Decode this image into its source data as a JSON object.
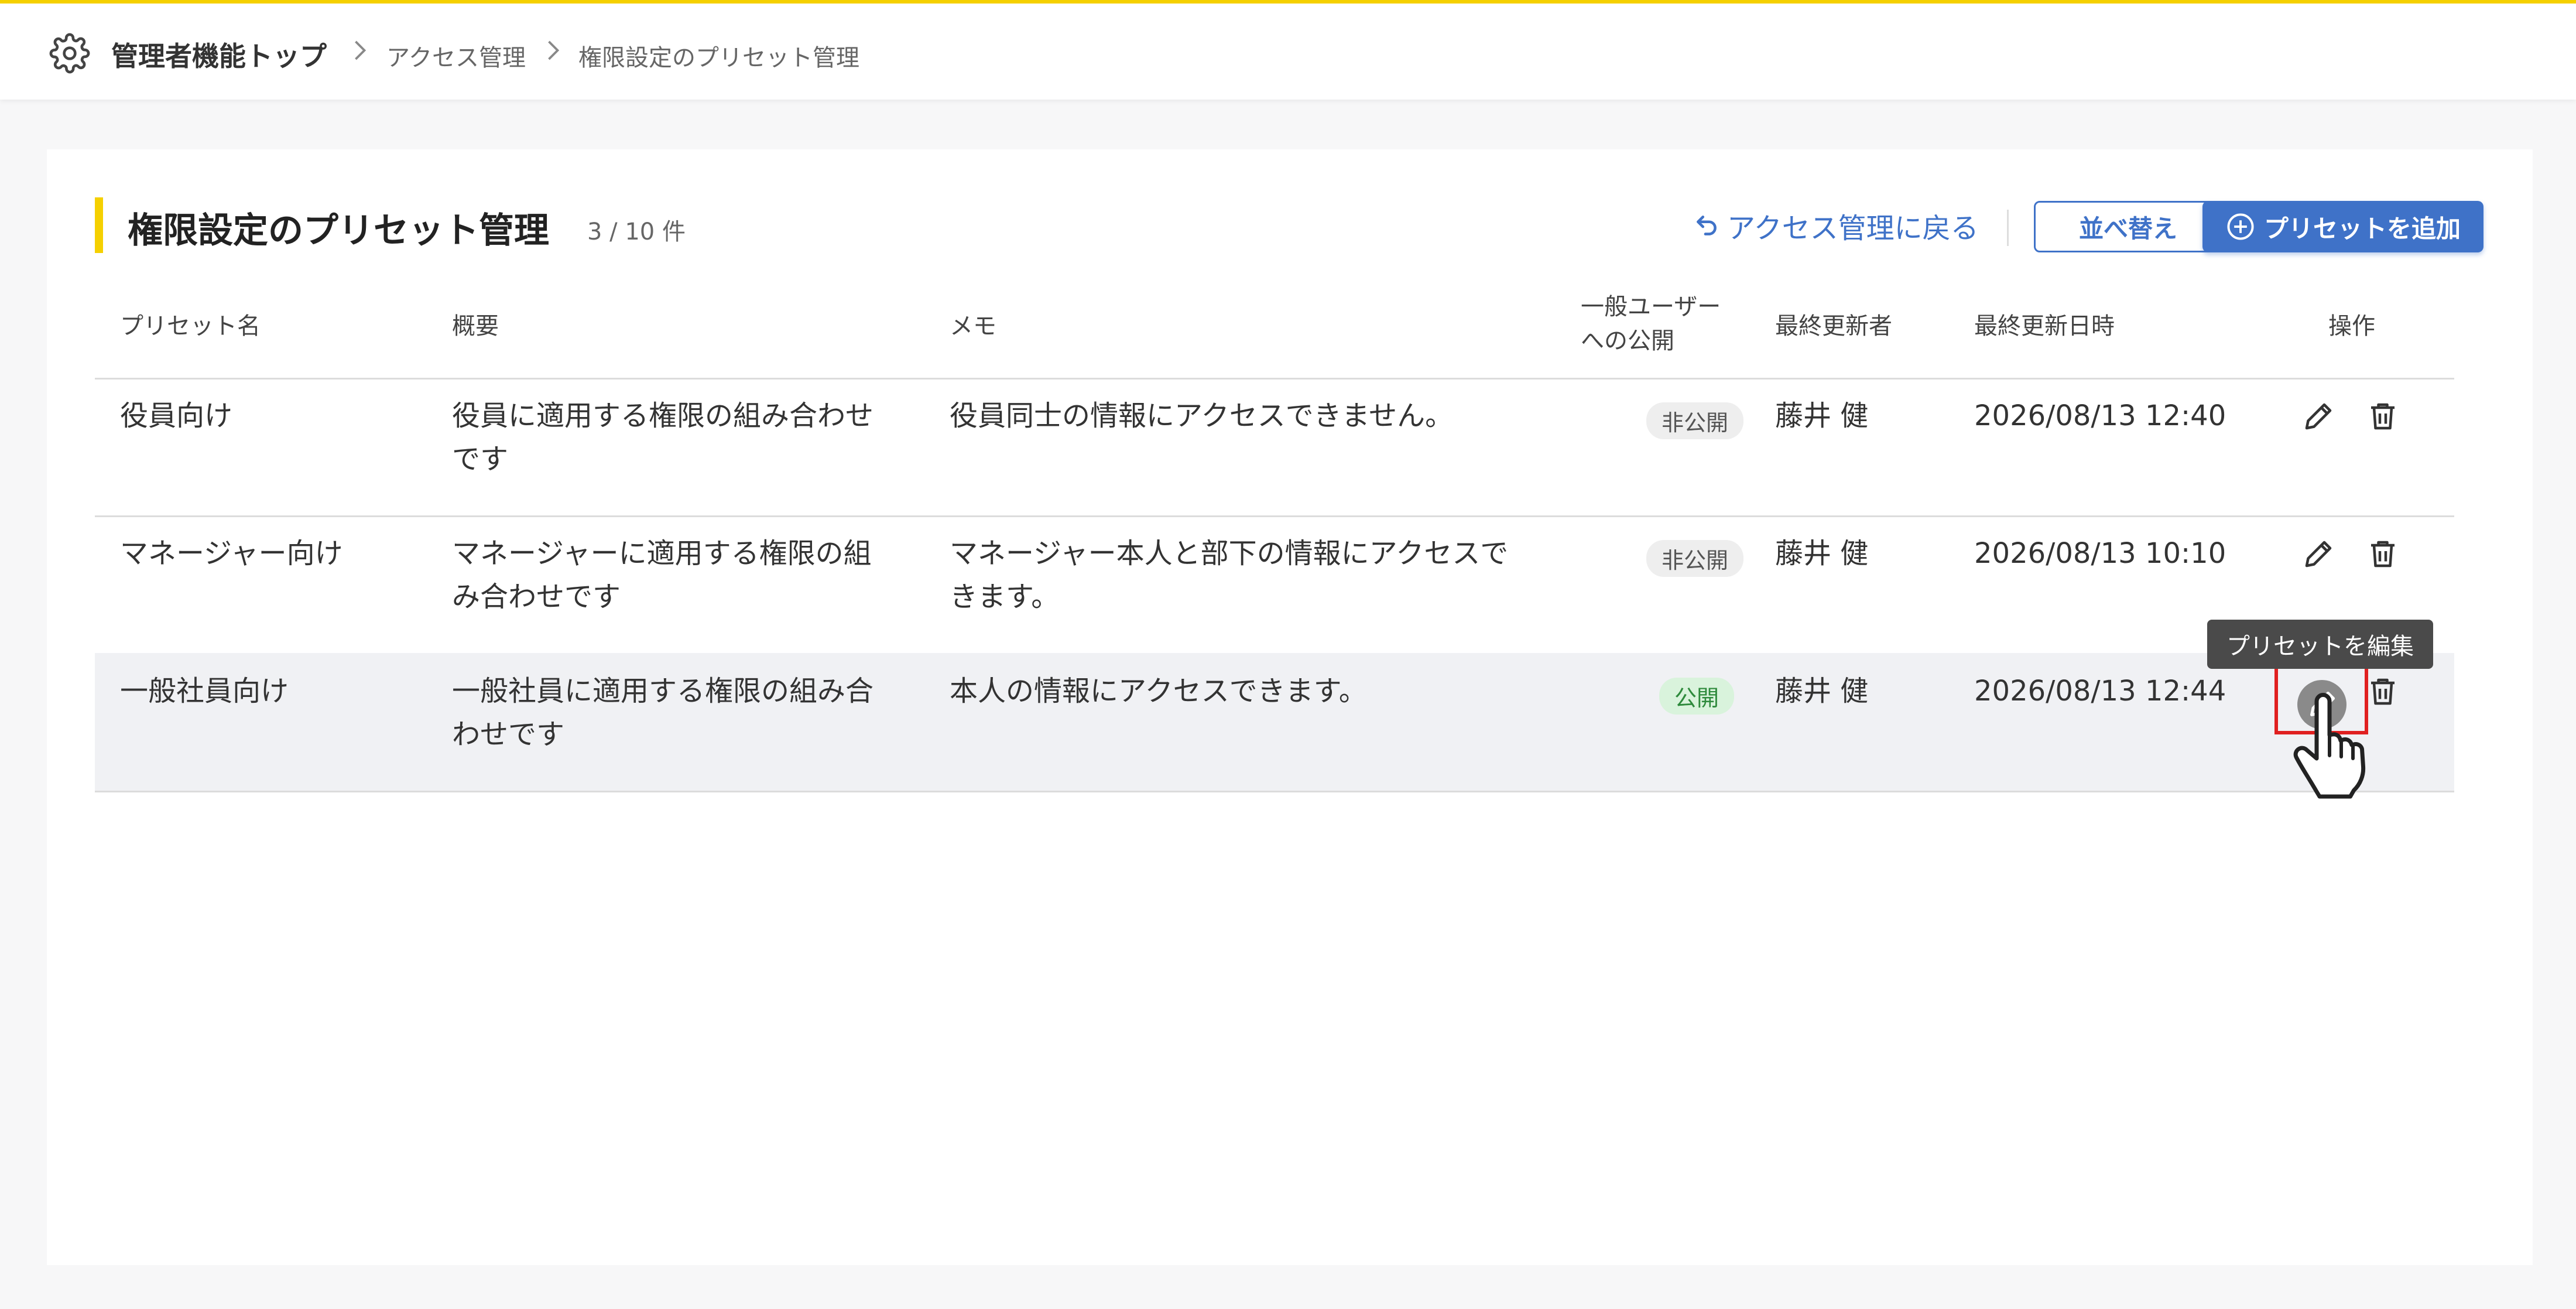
{
  "topbar": {
    "home": "管理者機能トップ",
    "crumb1": "アクセス管理",
    "crumb2": "権限設定のプリセット管理"
  },
  "page": {
    "title": "権限設定のプリセット管理",
    "count": "3 / 10 件",
    "back_link": "アクセス管理に戻る",
    "sort_button": "並べ替え",
    "add_button": "プリセットを追加"
  },
  "table": {
    "headers": {
      "name": "プリセット名",
      "summary": "概要",
      "memo": "メモ",
      "public_line1": "一般ユーザー",
      "public_line2": "への公開",
      "updater": "最終更新者",
      "updated_at": "最終更新日時",
      "actions": "操作"
    },
    "rows": [
      {
        "name": "役員向け",
        "summary1": "役員に適用する権限の組み合わせ",
        "summary2": "です",
        "memo1": "役員同士の情報にアクセスできません。",
        "memo2": "",
        "visibility": "非公開",
        "updater": "藤井 健",
        "updated_at": "2026/08/13 12:40"
      },
      {
        "name": "マネージャー向け",
        "summary1": "マネージャーに適用する権限の組",
        "summary2": "み合わせです",
        "memo1": "マネージャー本人と部下の情報にアクセスで",
        "memo2": "きます。",
        "visibility": "非公開",
        "updater": "藤井 健",
        "updated_at": "2026/08/13 10:10"
      },
      {
        "name": "一般社員向け",
        "summary1": "一般社員に適用する権限の組み合",
        "summary2": "わせです",
        "memo1": "本人の情報にアクセスできます。",
        "memo2": "",
        "visibility": "公開",
        "updater": "藤井 健",
        "updated_at": "2026/08/13 12:44"
      }
    ]
  },
  "tooltip": "プリセットを編集",
  "colors": {
    "accent": "#3f72c8",
    "brand_yellow": "#f5d000",
    "highlight": "#e02020",
    "public_badge_bg": "#d9f3dc",
    "public_badge_text": "#2e8a3c"
  },
  "icons": [
    "gear-icon",
    "chevron-right-icon",
    "undo-icon",
    "plus-circle-icon",
    "pencil-icon",
    "trash-icon",
    "hand-pointer-icon"
  ]
}
